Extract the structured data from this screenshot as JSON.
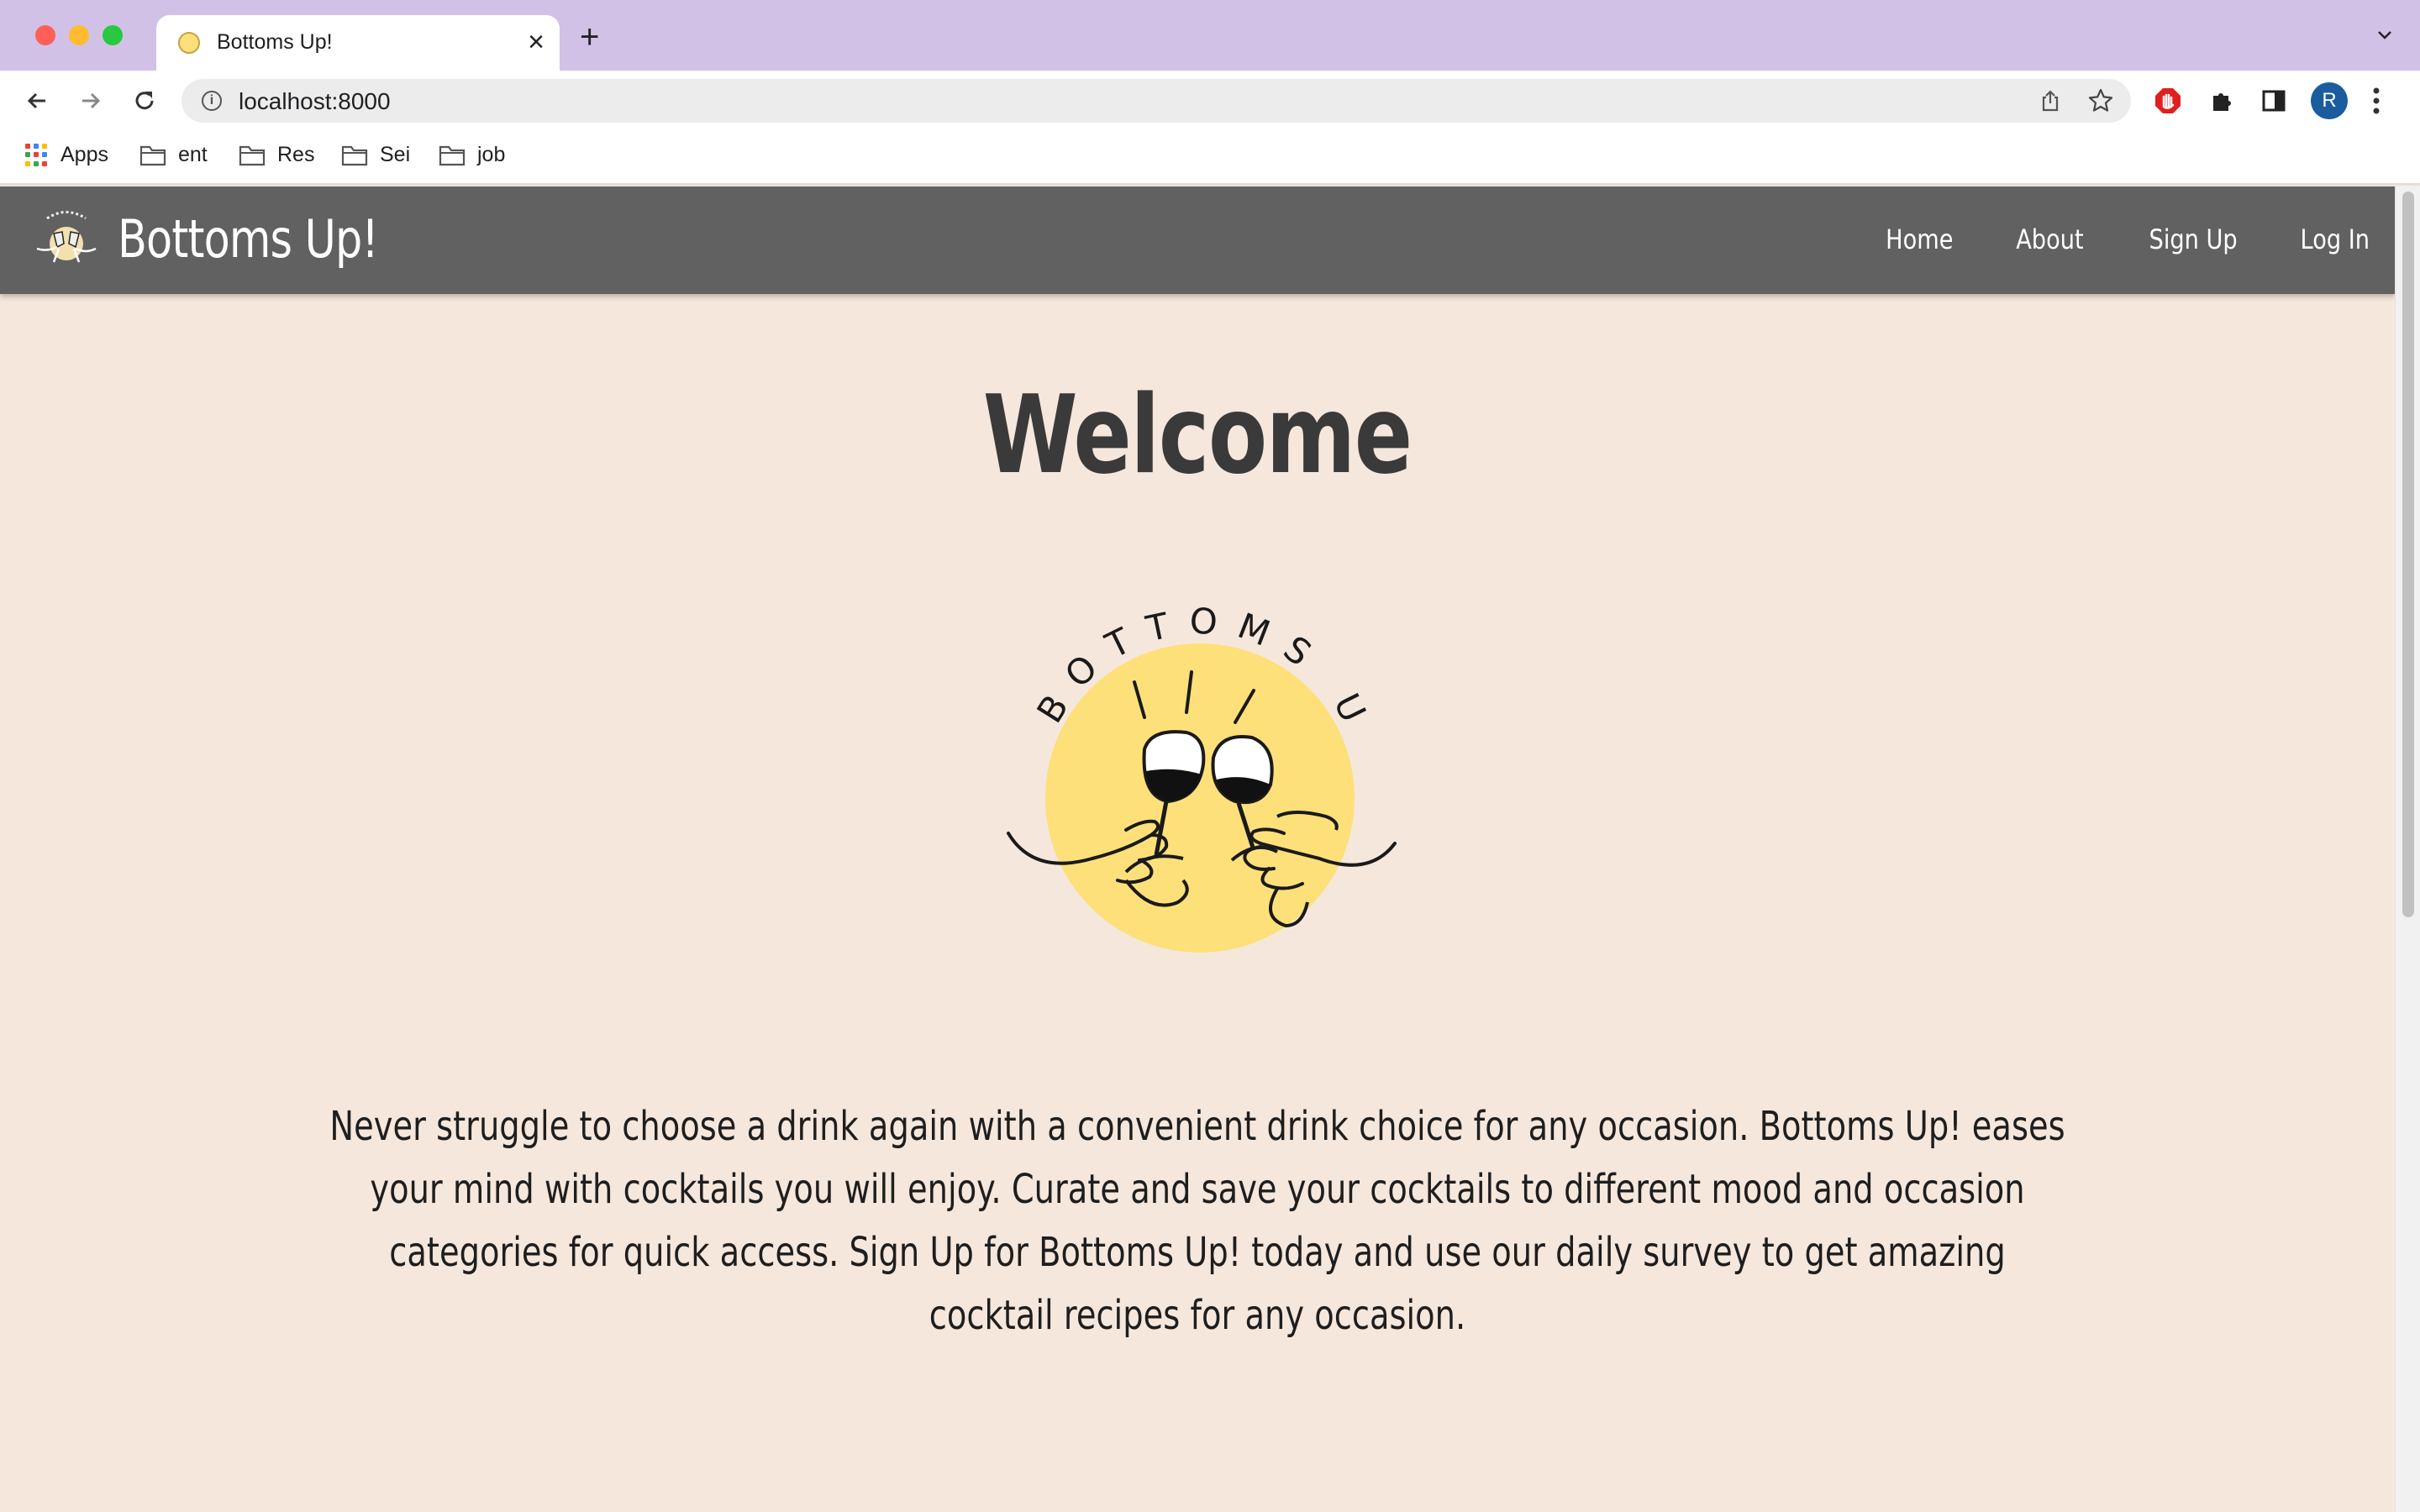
{
  "browser": {
    "tab_title": "Bottoms Up!",
    "url": "localhost:8000",
    "avatar_letter": "R",
    "bookmarks": [
      {
        "label": "Apps",
        "icon": "apps-grid-icon"
      },
      {
        "label": "ent",
        "icon": "folder-icon"
      },
      {
        "label": "Res",
        "icon": "folder-icon"
      },
      {
        "label": "Sei",
        "icon": "folder-icon"
      },
      {
        "label": "job",
        "icon": "folder-icon"
      }
    ]
  },
  "navbar": {
    "brand": "Bottoms Up!",
    "links": [
      "Home",
      "About",
      "Sign Up",
      "Log In"
    ],
    "background": "#616161"
  },
  "main": {
    "heading": "Welcome",
    "logo_text": "BOTTOMS UP!",
    "description": "Never struggle to choose a drink again with a convenient drink choice for any occasion. Bottoms Up! eases your mind with cocktails you will enjoy. Curate and save your cocktails to different mood and occasion categories for quick access. Sign Up for Bottoms Up! today and use our daily survey to get amazing cocktail recipes for any occasion."
  },
  "colors": {
    "page_background": "#f6e7dc",
    "logo_sun": "#fde07a",
    "tab_strip": "#d1c1e7"
  }
}
